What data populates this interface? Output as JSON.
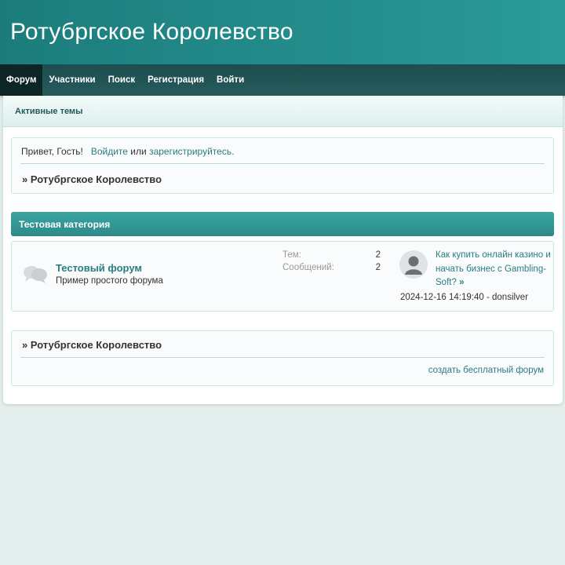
{
  "site": {
    "title": "Ротубргское Королевство"
  },
  "nav": {
    "items": [
      {
        "label": "Форум"
      },
      {
        "label": "Участники"
      },
      {
        "label": "Поиск"
      },
      {
        "label": "Регистрация"
      },
      {
        "label": "Войти"
      }
    ]
  },
  "subnav": {
    "active_topics": "Активные темы"
  },
  "welcome": {
    "greeting": "Привет, Гость!",
    "login_link": "Войдите",
    "or": "или",
    "register_link": "зарегистрируйтесь."
  },
  "breadcrumb": {
    "text": "» Ротубргское Королевство"
  },
  "category": {
    "title": "Тестовая категория",
    "forum": {
      "icon": "speech-bubbles-icon",
      "title": "Тестовый форум",
      "description": "Пример простого форума",
      "topics_label": "Тем:",
      "topics_value": "2",
      "posts_label": "Сообщений:",
      "posts_value": "2",
      "last_post": {
        "avatar": "user-avatar-icon",
        "title": "Как купить онлайн казино и начать бизнес с Gambling-Soft?",
        "arrow": "»",
        "meta": "2024-12-16 14:19:40 - donsilver"
      }
    }
  },
  "footer": {
    "breadcrumb": "» Ротубргское Королевство",
    "create_forum": "создать бесплатный форум"
  },
  "colors": {
    "header": "#1c7c7c",
    "nav": "#265b5c",
    "link": "#2a7e80",
    "category": "#3aa5a2"
  }
}
